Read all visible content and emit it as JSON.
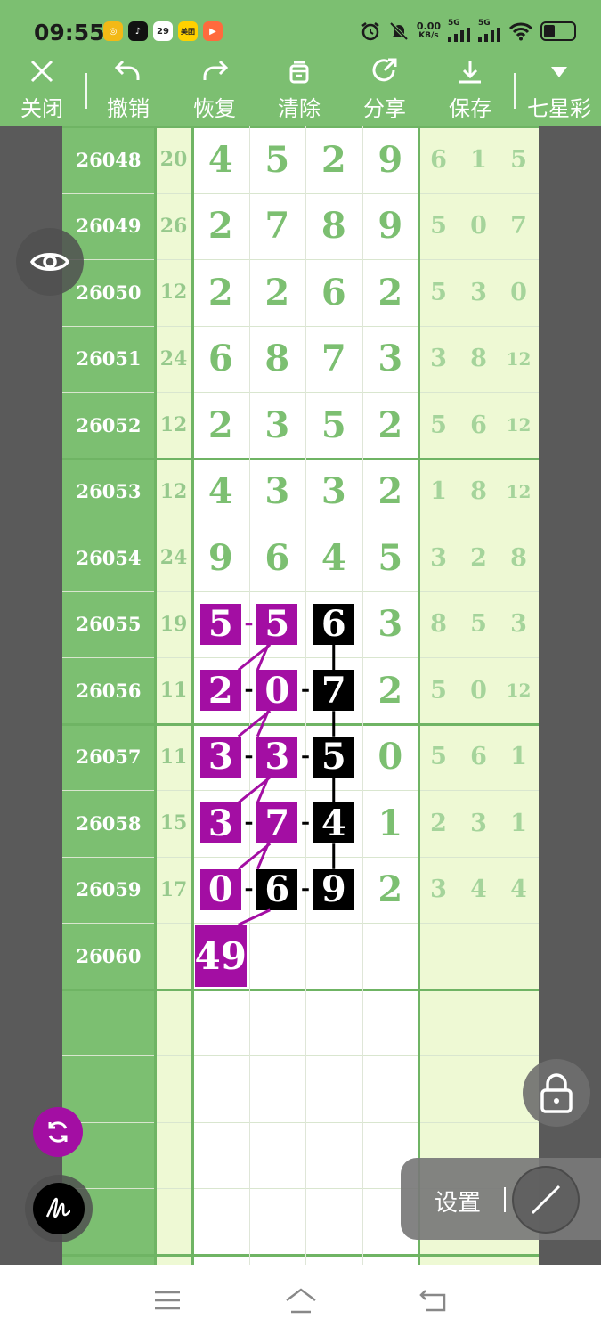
{
  "status_bar": {
    "time": "09:55",
    "app_icons": [
      {
        "name": "coin-app-icon",
        "glyph": "◎",
        "color": "#f3b916"
      },
      {
        "name": "tiktok-icon",
        "glyph": "♪",
        "color": "#111111"
      },
      {
        "name": "calendar-icon",
        "glyph": "29",
        "color": "#ffffff"
      },
      {
        "name": "meituan-icon",
        "glyph": "美团",
        "color": "#ffd100"
      },
      {
        "name": "video-app-icon",
        "glyph": "▶",
        "color": "#ff6a3d"
      }
    ],
    "net_speed_value": "0.00",
    "net_speed_unit": "KB/s",
    "signal_label_1": "5G",
    "signal_label_2": "5G"
  },
  "toolbar": {
    "close_label": "关闭",
    "undo_label": "撤销",
    "redo_label": "恢复",
    "clear_label": "清除",
    "share_label": "分享",
    "save_label": "保存",
    "lottery_label": "七星彩"
  },
  "table": {
    "rows": [
      {
        "issue": "26048",
        "sum": "20",
        "digits": [
          "4",
          "5",
          "2",
          "9"
        ],
        "tails": [
          "6",
          "1",
          "5"
        ]
      },
      {
        "issue": "26049",
        "sum": "26",
        "digits": [
          "2",
          "7",
          "8",
          "9"
        ],
        "tails": [
          "5",
          "0",
          "7"
        ]
      },
      {
        "issue": "26050",
        "sum": "12",
        "digits": [
          "2",
          "2",
          "6",
          "2"
        ],
        "tails": [
          "5",
          "3",
          "0"
        ]
      },
      {
        "issue": "26051",
        "sum": "24",
        "digits": [
          "6",
          "8",
          "7",
          "3"
        ],
        "tails": [
          "3",
          "8",
          "12"
        ]
      },
      {
        "issue": "26052",
        "sum": "12",
        "digits": [
          "2",
          "3",
          "5",
          "2"
        ],
        "tails": [
          "5",
          "6",
          "12"
        ]
      },
      {
        "issue": "26053",
        "sum": "12",
        "digits": [
          "4",
          "3",
          "3",
          "2"
        ],
        "tails": [
          "1",
          "8",
          "12"
        ]
      },
      {
        "issue": "26054",
        "sum": "24",
        "digits": [
          "9",
          "6",
          "4",
          "5"
        ],
        "tails": [
          "3",
          "2",
          "8"
        ]
      },
      {
        "issue": "26055",
        "sum": "19",
        "digits": [
          "5",
          "5",
          "6",
          "3"
        ],
        "tails": [
          "8",
          "5",
          "3"
        ]
      },
      {
        "issue": "26056",
        "sum": "11",
        "digits": [
          "2",
          "0",
          "7",
          "2"
        ],
        "tails": [
          "5",
          "0",
          "12"
        ]
      },
      {
        "issue": "26057",
        "sum": "11",
        "digits": [
          "3",
          "3",
          "5",
          "0"
        ],
        "tails": [
          "5",
          "6",
          "1"
        ]
      },
      {
        "issue": "26058",
        "sum": "15",
        "digits": [
          "3",
          "7",
          "4",
          "1"
        ],
        "tails": [
          "2",
          "3",
          "1"
        ]
      },
      {
        "issue": "26059",
        "sum": "17",
        "digits": [
          "0",
          "6",
          "9",
          "2"
        ],
        "tails": [
          "3",
          "4",
          "4"
        ]
      },
      {
        "issue": "26060",
        "sum": "",
        "digits": [
          "",
          "",
          "",
          ""
        ],
        "tails": [
          "",
          "",
          ""
        ]
      }
    ],
    "prediction_label": "49",
    "highlight_colors": {
      "magenta": "#a30ea3",
      "black": "#000000"
    }
  },
  "controls": {
    "settings_label": "设置"
  }
}
